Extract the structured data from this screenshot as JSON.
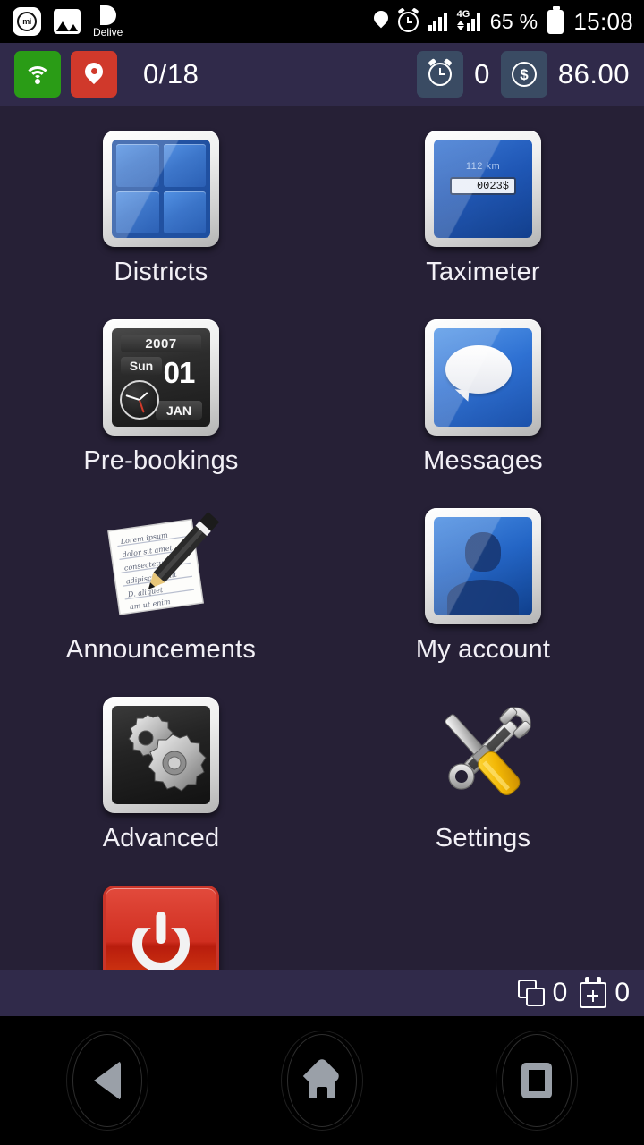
{
  "system_status_bar": {
    "notifications": [
      {
        "icon": "mi-app-icon",
        "label": "mi"
      },
      {
        "icon": "gallery-icon",
        "label": ""
      },
      {
        "icon": "delive-app-icon",
        "label": "Delive"
      }
    ],
    "right_icons": [
      "location-pin-icon",
      "alarm-clock-icon",
      "signal-bars-icon",
      "4g-signal-icon"
    ],
    "network_type": "4G",
    "battery_percent": "65 %",
    "clock": "15:08"
  },
  "app_header": {
    "wifi_icon": "wifi-icon",
    "location_icon": "location-pin-icon",
    "jobs_count": "0/18",
    "alarm_icon": "alarm-clock-icon",
    "alarm_count": "0",
    "money_icon": "dollar-coin-icon",
    "balance": "86.00",
    "colors": {
      "bar_background": "#302a4a",
      "wifi_tile": "#2a9c16",
      "location_tile": "#d0392b",
      "counter_tile": "#3a4b63"
    }
  },
  "menu": {
    "rows": [
      [
        {
          "id": "districts",
          "label": "Districts",
          "icon": "districts-grid-icon"
        },
        {
          "id": "taximeter",
          "label": "Taximeter",
          "icon": "taximeter-icon",
          "display": {
            "distance": "112 km",
            "fare": "0023$"
          }
        }
      ],
      [
        {
          "id": "pre-bookings",
          "label": "Pre-bookings",
          "icon": "calendar-clock-icon",
          "calendar": {
            "year": "2007",
            "weekday": "Sun",
            "day": "01",
            "month": "JAN"
          }
        },
        {
          "id": "messages",
          "label": "Messages",
          "icon": "speech-bubble-icon"
        }
      ],
      [
        {
          "id": "announcements",
          "label": "Announcements",
          "icon": "note-pencil-icon",
          "note_lines": [
            "Lorem ipsum",
            "dolor sit amet",
            "consectetur",
            "adipiscing elit",
            "D.  aliquet",
            "am ut enim"
          ]
        },
        {
          "id": "my-account",
          "label": "My account",
          "icon": "user-avatar-icon"
        }
      ],
      [
        {
          "id": "advanced",
          "label": "Advanced",
          "icon": "gears-icon"
        },
        {
          "id": "settings",
          "label": "Settings",
          "icon": "wrench-screwdriver-icon"
        }
      ],
      [
        {
          "id": "power-off",
          "label": "",
          "icon": "power-icon"
        },
        {
          "id": "placeholder",
          "label": "",
          "icon": ""
        }
      ]
    ]
  },
  "bottom_bar": {
    "copies_icon": "copy-layers-icon",
    "copies_count": "0",
    "schedule_icon": "calendar-plus-icon",
    "schedule_count": "0"
  },
  "navigation_bar": {
    "back": "back-triangle-icon",
    "home": "home-house-icon",
    "recents": "recents-square-icon"
  }
}
